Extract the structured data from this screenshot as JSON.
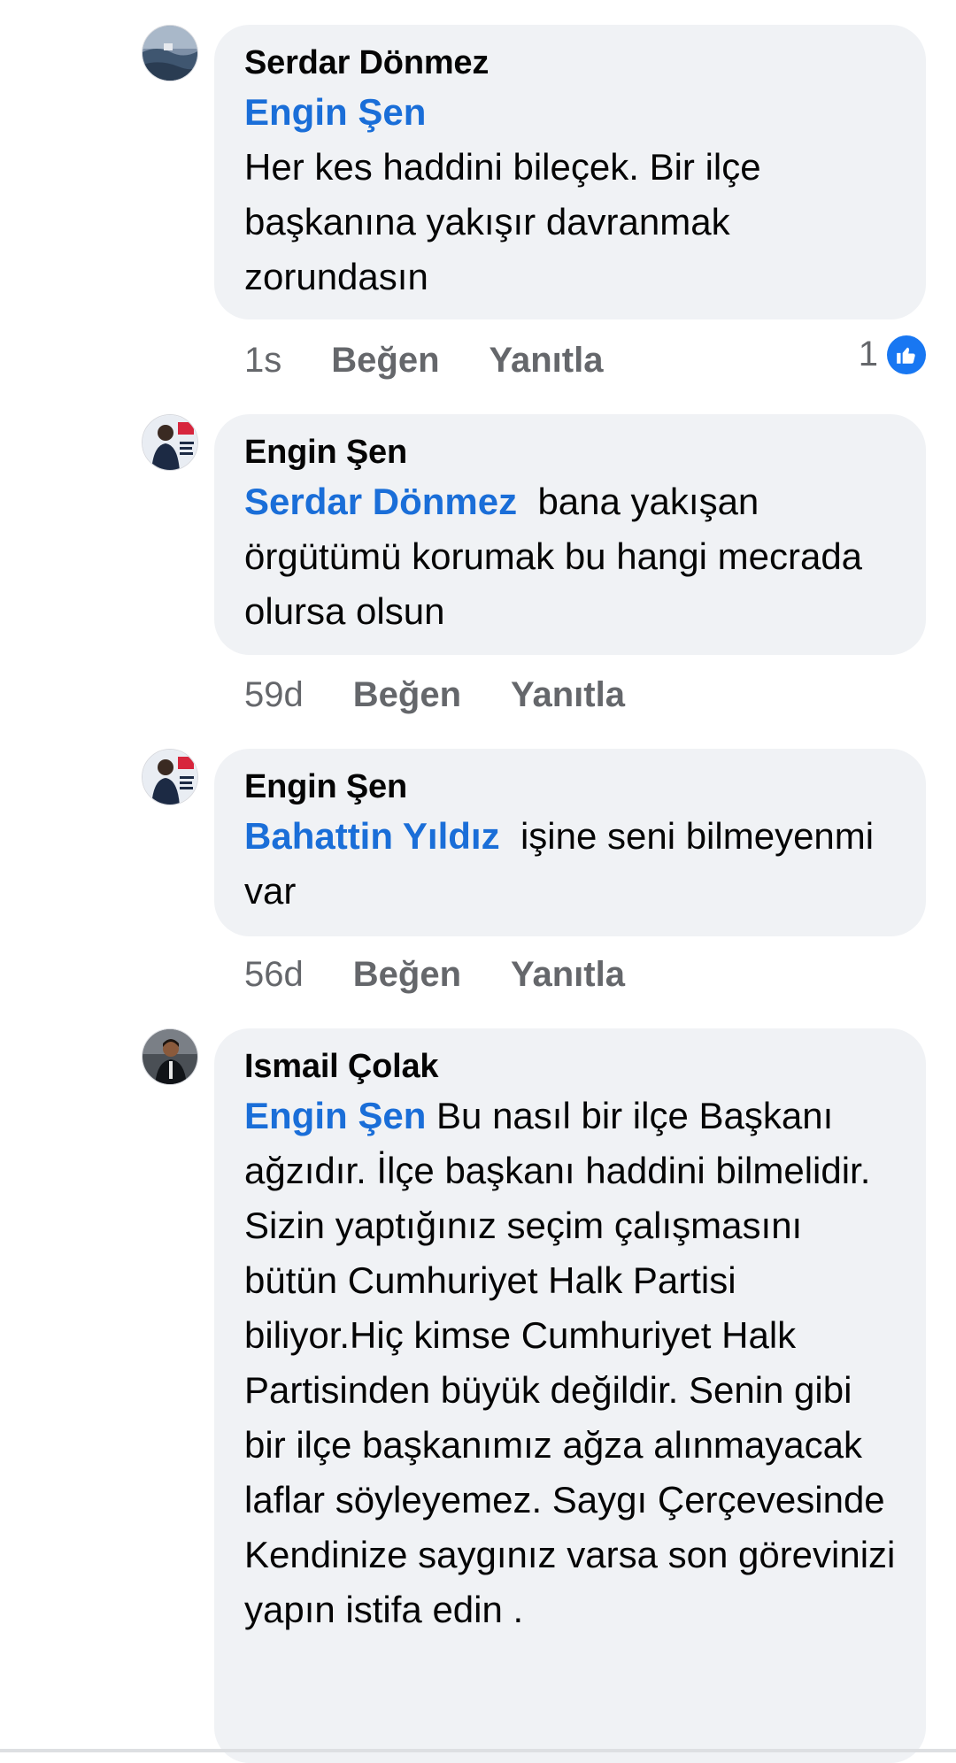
{
  "colors": {
    "mention": "#1a6ed8",
    "bubble_bg": "#f0f2f5",
    "meta_text": "#65676b",
    "like_blue": "#1877f2"
  },
  "comments": [
    {
      "author": "Serdar Dönmez",
      "mention": "Engin Şen",
      "text": "Her kes haddini bileçek. Bir ilçe başkanına yakışır davranmak zorundasın",
      "time": "1s",
      "like_label": "Beğen",
      "reply_label": "Yanıtla",
      "reaction_count": "1",
      "reaction_icon": "thumbs-up-icon",
      "avatar_icon": "avatar-photo-sea"
    },
    {
      "author": "Engin Şen",
      "mention": "Serdar Dönmez",
      "text": "bana yakışan örgütümü korumak bu hangi mecrada olursa olsun",
      "time": "59d",
      "like_label": "Beğen",
      "reply_label": "Yanıtla",
      "avatar_icon": "avatar-photo-chp"
    },
    {
      "author": "Engin Şen",
      "mention": "Bahattin Yıldız",
      "text": "işine seni bilmeyenmi var",
      "time": "56d",
      "like_label": "Beğen",
      "reply_label": "Yanıtla",
      "avatar_icon": "avatar-photo-chp"
    },
    {
      "author": "Ismail Çolak",
      "mention": "Engin Şen",
      "text": "Bu nasıl bir ilçe Başkanı ağzıdır. İlçe başkanı haddini bilmelidir. Sizin yaptığınız seçim çalışmasını bütün Cumhuriyet Halk Partisi biliyor.Hiç kimse Cumhuriyet Halk Partisinden büyük değildir. Senin gibi bir ilçe başkanımız ağza alınmayacak laflar söyleyemez. Saygı Çerçevesinde Kendinize saygınız varsa son görevinizi yapın istifa edin .",
      "avatar_icon": "avatar-photo-person"
    }
  ]
}
